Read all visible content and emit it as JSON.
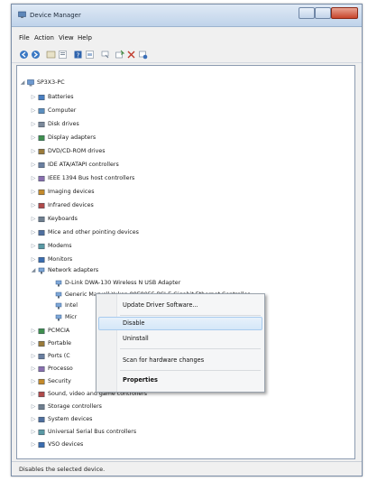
{
  "window": {
    "title": "Device Manager"
  },
  "menubar": {
    "items": [
      "File",
      "Action",
      "View",
      "Help"
    ]
  },
  "toolbar": {
    "buttons": [
      "back-icon",
      "forward-icon",
      "up-icon",
      "properties-icon",
      "help-icon",
      "show-hidden-icon",
      "scan-icon",
      "update-driver-icon",
      "uninstall-icon",
      "disable-icon"
    ]
  },
  "tree": {
    "root": "SP3X3-PC",
    "categories": [
      "Batteries",
      "Computer",
      "Disk drives",
      "Display adapters",
      "DVD/CD-ROM drives",
      "IDE ATA/ATAPI controllers",
      "IEEE 1394 Bus host controllers",
      "Imaging devices",
      "Infrared devices",
      "Keyboards",
      "Mice and other pointing devices",
      "Modems",
      "Monitors",
      "Network adapters"
    ],
    "network_children": [
      "D-Link DWA-130 Wireless N USB Adapter",
      "Generic Marvell Yukon 88E8055 PCI-E Gigabit Ethernet Controller",
      "Intel",
      "Micr"
    ],
    "categories_after": [
      "PCMCIA",
      "Portable",
      "Ports (C",
      "Processo",
      "Security",
      "Sound, video and game controllers",
      "Storage controllers",
      "System devices",
      "Universal Serial Bus controllers",
      "VSO devices"
    ]
  },
  "context_menu": {
    "items": [
      "Update Driver Software...",
      "Disable",
      "Uninstall",
      "Scan for hardware changes",
      "Properties"
    ],
    "highlighted": "Disable"
  },
  "statusbar": {
    "text": "Disables the selected device."
  },
  "colors": {
    "title_gradient_top": "#dfe9f5",
    "title_gradient_bottom": "#bfd3ea",
    "close_button": "#c8452c",
    "menu_highlight": "#d5e7f8"
  }
}
